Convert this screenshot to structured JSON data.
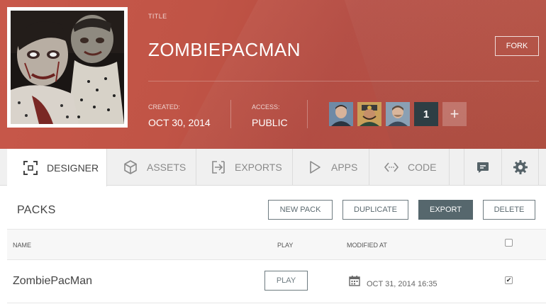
{
  "header": {
    "title_label": "TITLE",
    "title": "ZOMBIEPACMAN",
    "fork_label": "FORK",
    "created_label": "CREATED:",
    "created_value": "OCT 30, 2014",
    "access_label": "ACCESS:",
    "access_value": "PUBLIC",
    "collaborator_count": "1",
    "add_collaborator_symbol": "+",
    "accent_color": "#c05446"
  },
  "tabs": [
    {
      "label": "DESIGNER",
      "icon": "designer-frame-icon",
      "active": true
    },
    {
      "label": "ASSETS",
      "icon": "cube-icon",
      "active": false
    },
    {
      "label": "EXPORTS",
      "icon": "export-arrow-icon",
      "active": false
    },
    {
      "label": "APPS",
      "icon": "play-triangle-icon",
      "active": false
    },
    {
      "label": "CODE",
      "icon": "code-brackets-icon",
      "active": false
    }
  ],
  "tab_icons": {
    "chat": "chat-bubble-icon",
    "settings": "gear-icon"
  },
  "packs": {
    "title": "PACKS",
    "buttons": {
      "new_pack": "NEW PACK",
      "duplicate": "DUPLICATE",
      "export": "EXPORT",
      "delete": "DELETE"
    },
    "columns": {
      "name": "NAME",
      "play": "PLAY",
      "modified": "MODIFIED AT"
    },
    "rows": [
      {
        "name": "ZombiePacMan",
        "play_label": "PLAY",
        "modified": "OCT 31, 2014 16:35",
        "checked": true
      }
    ]
  }
}
